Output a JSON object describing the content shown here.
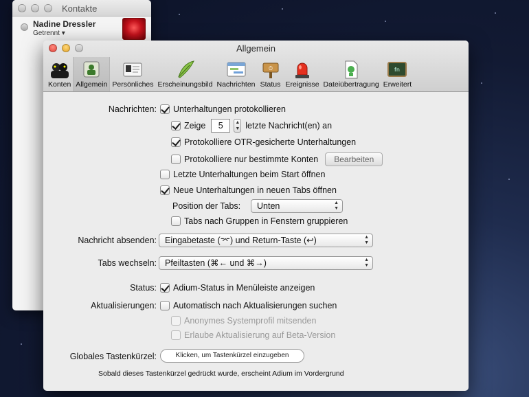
{
  "contacts_window": {
    "title": "Kontakte",
    "contact": {
      "name": "Nadine Dressler",
      "status": "Getrennt"
    }
  },
  "prefs_window": {
    "title": "Allgemein",
    "toolbar": [
      {
        "label": "Konten",
        "icon": "accounts-icon"
      },
      {
        "label": "Allgemein",
        "icon": "general-icon",
        "selected": true
      },
      {
        "label": "Persönliches",
        "icon": "personal-icon"
      },
      {
        "label": "Erscheinungsbild",
        "icon": "appearance-icon"
      },
      {
        "label": "Nachrichten",
        "icon": "messages-icon"
      },
      {
        "label": "Status",
        "icon": "status-icon"
      },
      {
        "label": "Ereignisse",
        "icon": "events-icon"
      },
      {
        "label": "Dateiübertragung",
        "icon": "file-transfer-icon"
      },
      {
        "label": "Erweitert",
        "icon": "advanced-icon"
      }
    ],
    "messages": {
      "label": "Nachrichten:",
      "log_chats": {
        "label": "Unterhaltungen protokollieren",
        "checked": true
      },
      "show": {
        "label": "Zeige",
        "value": "5",
        "suffix": "letzte Nachricht(en) an",
        "checked": true
      },
      "log_otr": {
        "label": "Protokolliere OTR-gesicherte Unterhaltungen",
        "checked": true
      },
      "log_specific": {
        "label": "Protokolliere nur bestimmte Konten",
        "checked": false,
        "button": "Bearbeiten"
      },
      "open_last": {
        "label": "Letzte Unterhaltungen beim Start öffnen",
        "checked": false
      },
      "new_tabs": {
        "label": "Neue Unterhaltungen in neuen Tabs öffnen",
        "checked": true
      },
      "tab_position": {
        "label": "Position der Tabs:",
        "value": "Unten"
      },
      "group_tabs": {
        "label": "Tabs nach Gruppen in Fenstern gruppieren",
        "checked": false
      }
    },
    "send_message": {
      "label": "Nachricht absenden:",
      "value": "Eingabetaste (⌤) und Return-Taste (↩)"
    },
    "switch_tabs": {
      "label": "Tabs wechseln:",
      "value": "Pfeiltasten (⌘← und ⌘→)"
    },
    "status": {
      "label": "Status:",
      "option": "Adium-Status in Menüleiste anzeigen",
      "checked": true
    },
    "updates": {
      "label": "Aktualisierungen:",
      "auto": {
        "label": "Automatisch nach Aktualisierungen suchen",
        "checked": false
      },
      "profile": {
        "label": "Anonymes Systemprofil mitsenden",
        "checked": false
      },
      "beta": {
        "label": "Erlaube Aktualisierung auf Beta-Version",
        "checked": false
      }
    },
    "hotkey": {
      "label": "Globales Tastenkürzel:",
      "placeholder": "Klicken, um Tastenkürzel einzugeben",
      "note": "Sobald dieses Tastenkürzel gedrückt wurde, erscheint Adium im Vordergrund"
    }
  }
}
